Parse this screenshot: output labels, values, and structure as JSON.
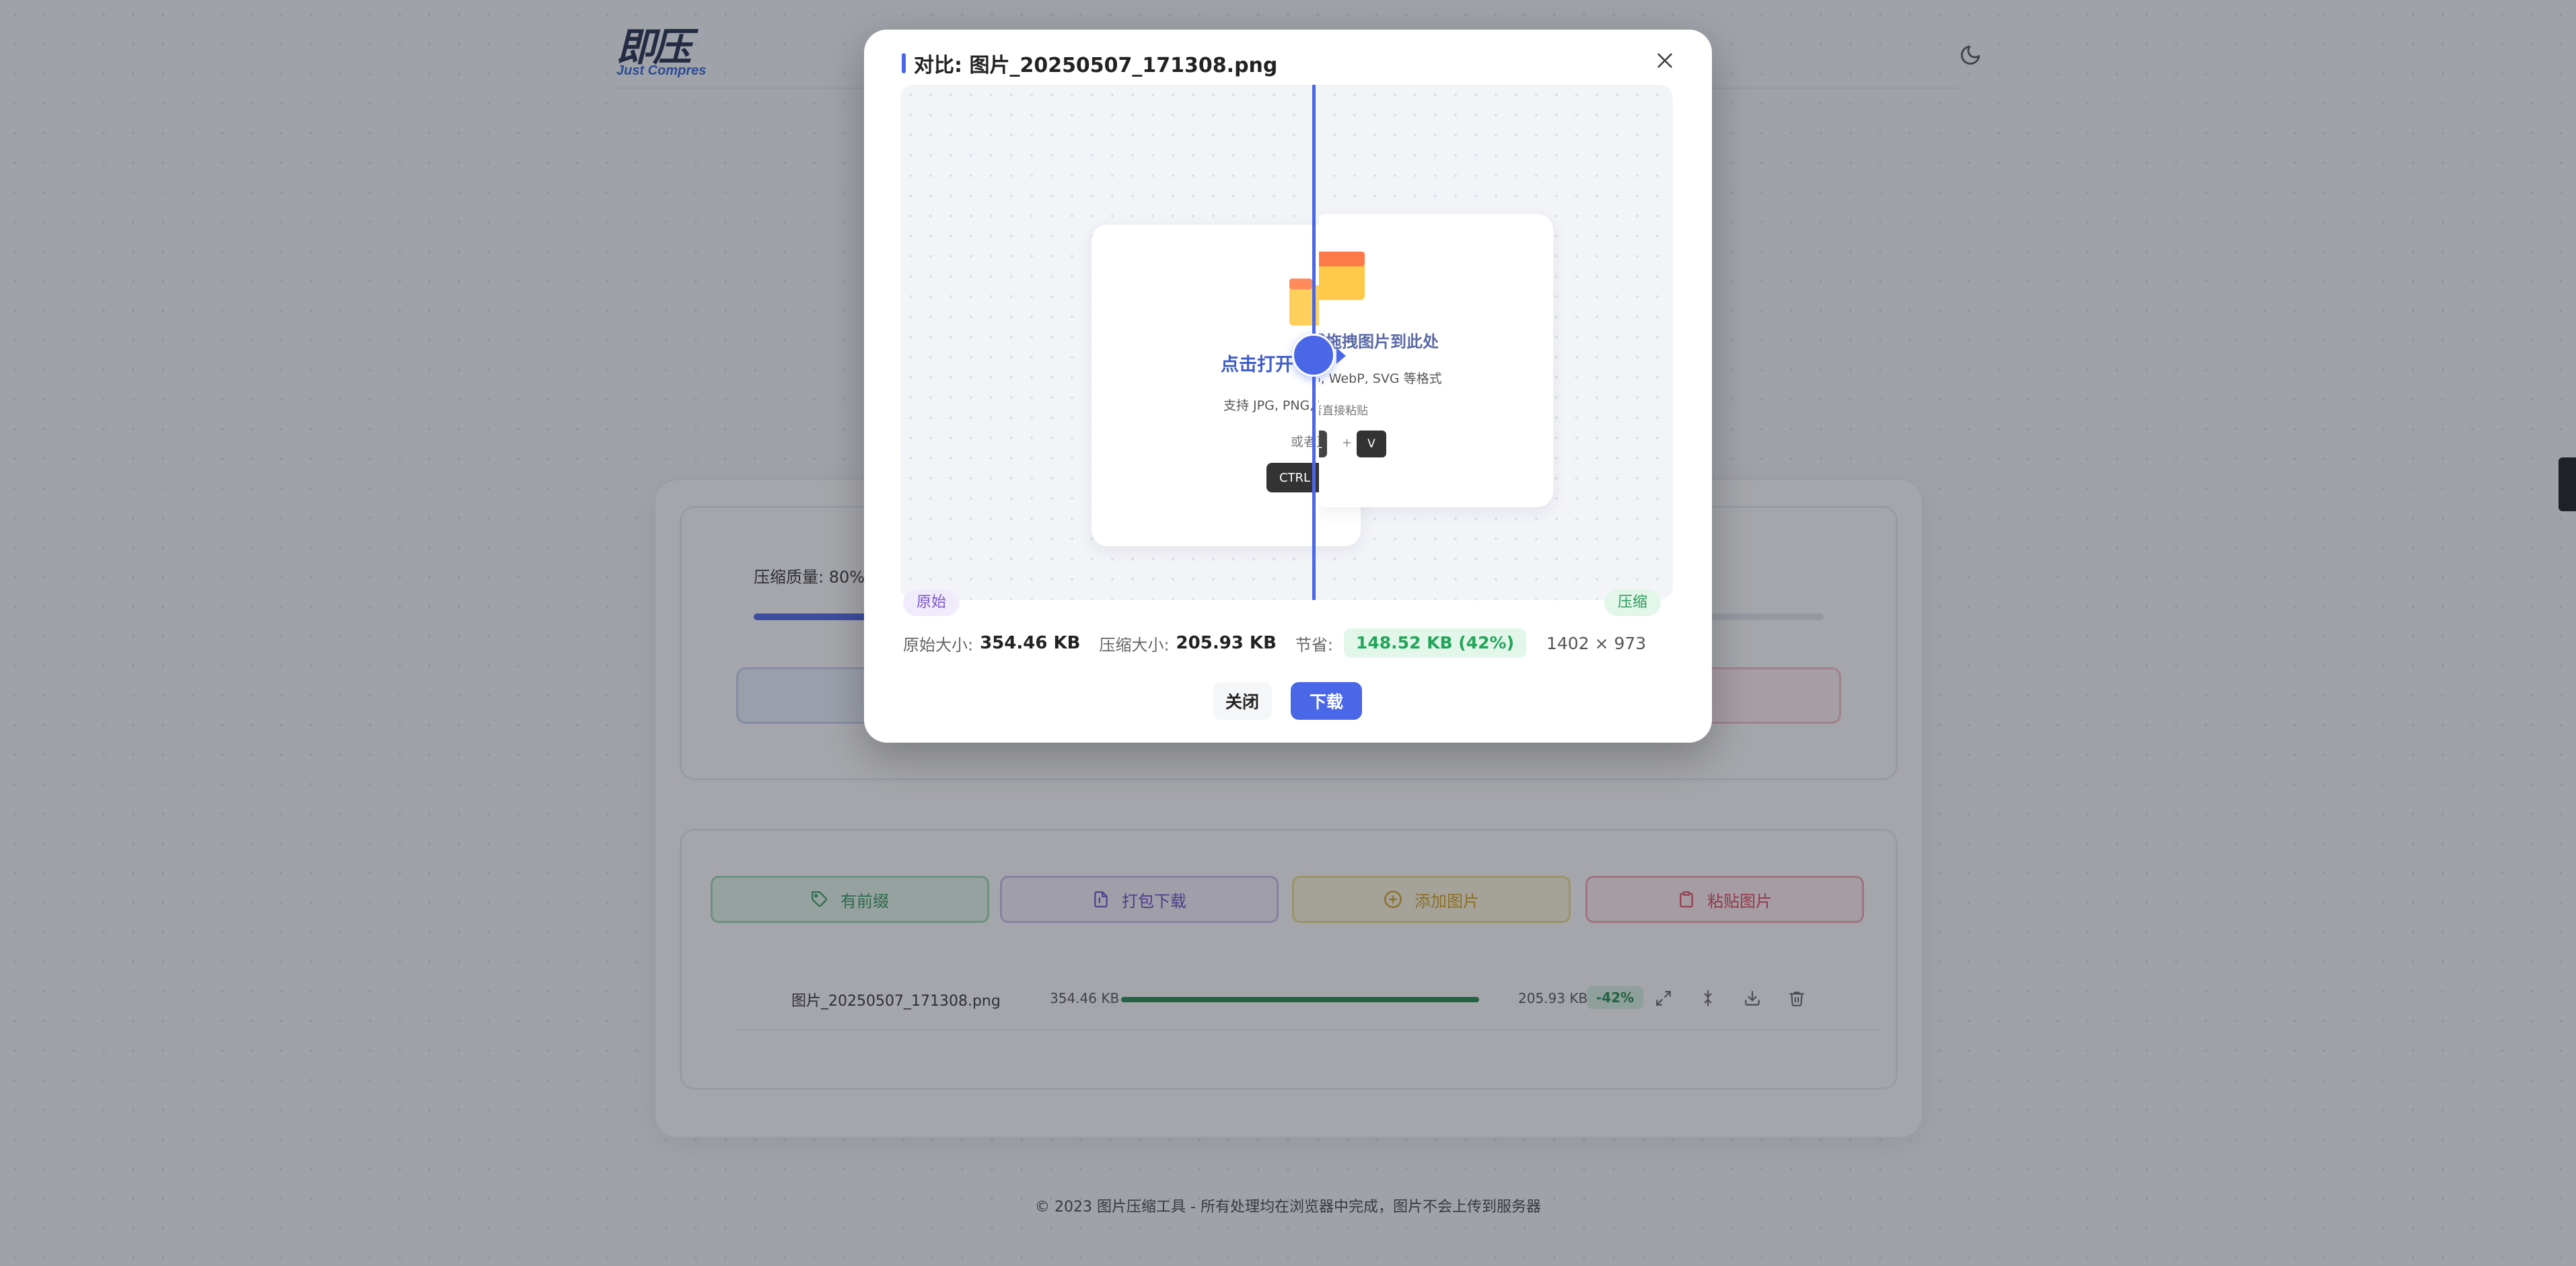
{
  "header": {
    "logo_cn": "即压",
    "logo_en": "Just Compres"
  },
  "settings": {
    "quality_label": "压缩质量: 80%",
    "quality_value": 80
  },
  "actions": {
    "prefix": "有前缀",
    "zip_download": "打包下载",
    "add_images": "添加图片",
    "paste_images": "粘贴图片"
  },
  "file_list": [
    {
      "name": "图片_20250507_171308.png",
      "original_size": "354.46 KB",
      "compressed_size": "205.93 KB",
      "reduction": "-42%"
    }
  ],
  "footer": {
    "text": "© 2023 图片压缩工具 - 所有处理均在浏览器中完成，图片不会上传到服务器"
  },
  "modal": {
    "title": "对比: 图片_20250507_171308.png",
    "preview": {
      "left_title": "点击打开",
      "left_sub": "支持 JPG, PNG, We",
      "left_paste": "或者直接",
      "ctrl_key": "CTRL",
      "right_title": "或拖拽图片到此处",
      "right_sub": "G, WebP, SVG 等格式",
      "right_paste": "者直接粘贴",
      "key_l": "L",
      "plus": "+",
      "key_v": "V"
    },
    "tag_original": "原始",
    "tag_compressed": "压缩",
    "stats": {
      "original_label": "原始大小:",
      "original_value": "354.46 KB",
      "compressed_label": "压缩大小:",
      "compressed_value": "205.93 KB",
      "saving_label": "节省:",
      "saving_value": "148.52 KB (42%)",
      "dimensions": "1402 × 973"
    },
    "close_button": "关闭",
    "download_button": "下载"
  }
}
